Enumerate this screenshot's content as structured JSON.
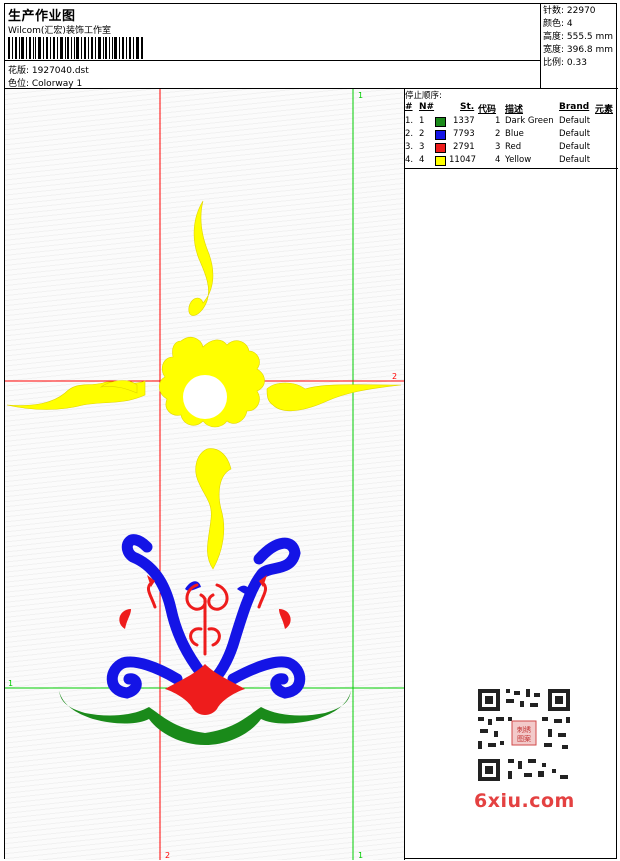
{
  "header": {
    "title": "生产作业图",
    "company": "Wilcom(汇宏)装饰工作室",
    "file_label": "花版: 1927040.dst",
    "colorway_label": "色位:  Colorway 1"
  },
  "stats": {
    "stitches": "针数: 22970",
    "colors": "颜色: 4",
    "height": "高度: 555.5 mm",
    "width": "宽度: 396.8 mm",
    "scale": "比例: 0.33"
  },
  "stop_sequence": {
    "title": "停止顺序:",
    "headers": {
      "hash": "#",
      "n": "N#",
      "st": "St.",
      "code": "代码",
      "desc": "描述",
      "brand": "Brand",
      "elem": "元素"
    },
    "rows": [
      {
        "hash": "1.",
        "n": "1",
        "st": "1337",
        "code": "1",
        "desc": "Dark Green",
        "brand": "Default",
        "color": "#1a8a1a"
      },
      {
        "hash": "2.",
        "n": "2",
        "st": "7793",
        "code": "2",
        "desc": "Blue",
        "brand": "Default",
        "color": "#1414e6"
      },
      {
        "hash": "3.",
        "n": "3",
        "st": "2791",
        "code": "3",
        "desc": "Red",
        "brand": "Default",
        "color": "#ee1c1c"
      },
      {
        "hash": "4.",
        "n": "4",
        "st": "11047",
        "code": "4",
        "desc": "Yellow",
        "brand": "Default",
        "color": "#ffff00"
      }
    ]
  },
  "guides": {
    "h1_label": "1",
    "h2_label": "2",
    "v1_label": "1",
    "v2_label": "2"
  },
  "colors": {
    "yellow": "#ffff00",
    "blue": "#1414e6",
    "red": "#ee1c1c",
    "green": "#1a8a1a",
    "guide_red": "#ff0000",
    "guide_green": "#00cc00"
  },
  "watermark": {
    "text": "6xiu.com",
    "qr_stamp": "刺绣图案"
  }
}
